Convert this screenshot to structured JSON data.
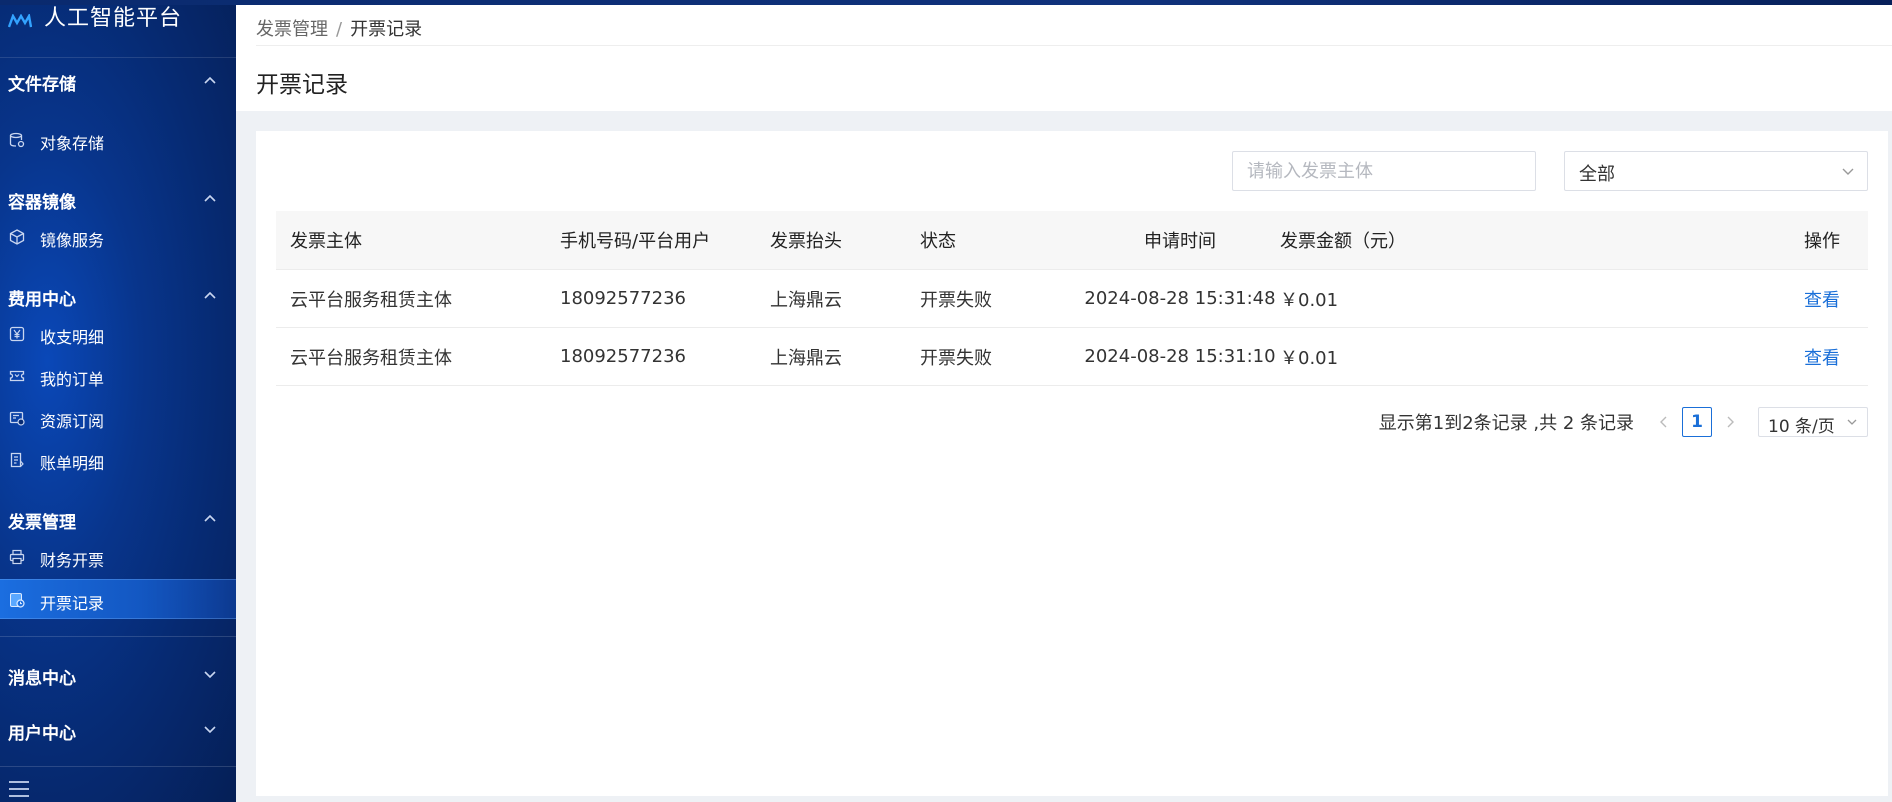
{
  "app": {
    "logo_text": "人工智能平台"
  },
  "sidebar": {
    "groups": [
      {
        "title": "文件存储",
        "items": [
          {
            "label": "对象存储",
            "icon": "database-icon"
          }
        ]
      },
      {
        "title": "容器镜像",
        "items": [
          {
            "label": "镜像服务",
            "icon": "cube-icon"
          }
        ]
      },
      {
        "title": "费用中心",
        "items": [
          {
            "label": "收支明细",
            "icon": "yen-icon"
          },
          {
            "label": "我的订单",
            "icon": "ticket-icon"
          },
          {
            "label": "资源订阅",
            "icon": "subscription-icon"
          },
          {
            "label": "账单明细",
            "icon": "bill-icon"
          }
        ]
      },
      {
        "title": "发票管理",
        "items": [
          {
            "label": "财务开票",
            "icon": "printer-icon"
          },
          {
            "label": "开票记录",
            "icon": "invoice-record-icon",
            "active": true
          }
        ]
      },
      {
        "title": "消息中心",
        "items": []
      },
      {
        "title": "用户中心",
        "items": []
      }
    ]
  },
  "breadcrumb": {
    "parent": "发票管理",
    "separator": "/",
    "current": "开票记录"
  },
  "page": {
    "title": "开票记录"
  },
  "filters": {
    "search_placeholder": "请输入发票主体",
    "search_value": "",
    "status_value": "全部"
  },
  "table": {
    "columns": [
      "发票主体",
      "手机号码/平台用户",
      "发票抬头",
      "状态",
      "申请时间",
      "发票金额（元）",
      "操作"
    ],
    "rows": [
      {
        "subject": "云平台服务租赁主体",
        "phone": "18092577236",
        "header": "上海鼎云",
        "status": "开票失败",
        "time": "2024-08-28 15:31:48",
        "amount": "￥0.01",
        "action": "查看"
      },
      {
        "subject": "云平台服务租赁主体",
        "phone": "18092577236",
        "header": "上海鼎云",
        "status": "开票失败",
        "time": "2024-08-28 15:31:10",
        "amount": "￥0.01",
        "action": "查看"
      }
    ]
  },
  "pagination": {
    "summary": "显示第1到2条记录 ,共 2 条记录",
    "current_page": "1",
    "page_size": "10 条/页"
  },
  "colors": {
    "accent": "#1a6fd8",
    "sidebar_bg": "#062a72",
    "active_item": "#1b6ee0"
  }
}
